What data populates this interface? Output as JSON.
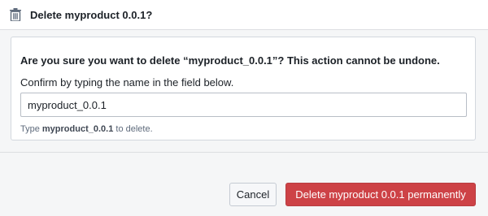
{
  "dialog": {
    "title": "Delete myproduct 0.0.1?",
    "icon": "trash-icon"
  },
  "confirm": {
    "warning": "Are you sure you want to delete “myproduct_0.0.1”? This action cannot be undone.",
    "instruction": "Confirm by typing the name in the field below.",
    "input_value": "myproduct_0.0.1",
    "helper_prefix": "Type ",
    "helper_name": "myproduct_0.0.1",
    "helper_suffix": " to delete."
  },
  "actions": {
    "cancel_label": "Cancel",
    "delete_label": "Delete myproduct 0.0.1 permanently"
  },
  "colors": {
    "danger": "#cd4246",
    "background": "#f5f6f7",
    "card": "#ffffff"
  }
}
